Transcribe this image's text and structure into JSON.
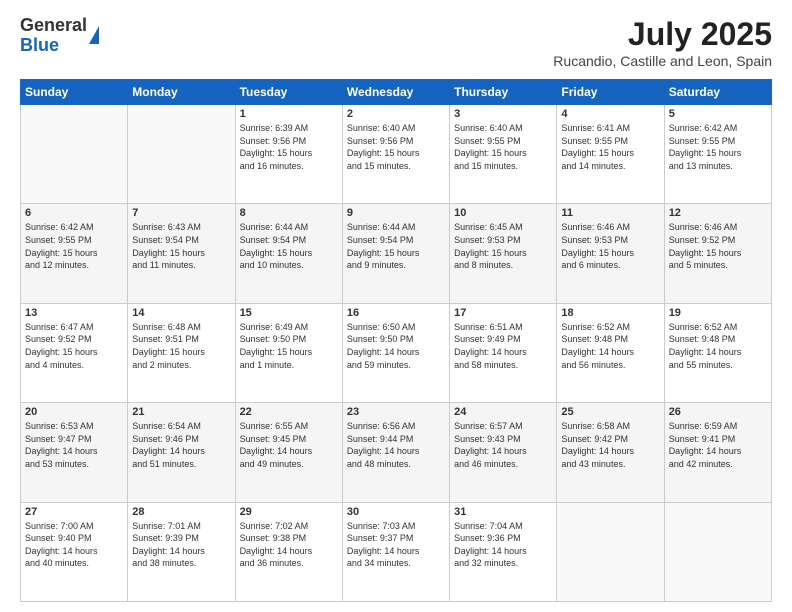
{
  "logo": {
    "line1": "General",
    "line2": "Blue"
  },
  "title": "July 2025",
  "subtitle": "Rucandio, Castille and Leon, Spain",
  "days_of_week": [
    "Sunday",
    "Monday",
    "Tuesday",
    "Wednesday",
    "Thursday",
    "Friday",
    "Saturday"
  ],
  "weeks": [
    [
      {
        "day": "",
        "info": ""
      },
      {
        "day": "",
        "info": ""
      },
      {
        "day": "1",
        "info": "Sunrise: 6:39 AM\nSunset: 9:56 PM\nDaylight: 15 hours\nand 16 minutes."
      },
      {
        "day": "2",
        "info": "Sunrise: 6:40 AM\nSunset: 9:56 PM\nDaylight: 15 hours\nand 15 minutes."
      },
      {
        "day": "3",
        "info": "Sunrise: 6:40 AM\nSunset: 9:55 PM\nDaylight: 15 hours\nand 15 minutes."
      },
      {
        "day": "4",
        "info": "Sunrise: 6:41 AM\nSunset: 9:55 PM\nDaylight: 15 hours\nand 14 minutes."
      },
      {
        "day": "5",
        "info": "Sunrise: 6:42 AM\nSunset: 9:55 PM\nDaylight: 15 hours\nand 13 minutes."
      }
    ],
    [
      {
        "day": "6",
        "info": "Sunrise: 6:42 AM\nSunset: 9:55 PM\nDaylight: 15 hours\nand 12 minutes."
      },
      {
        "day": "7",
        "info": "Sunrise: 6:43 AM\nSunset: 9:54 PM\nDaylight: 15 hours\nand 11 minutes."
      },
      {
        "day": "8",
        "info": "Sunrise: 6:44 AM\nSunset: 9:54 PM\nDaylight: 15 hours\nand 10 minutes."
      },
      {
        "day": "9",
        "info": "Sunrise: 6:44 AM\nSunset: 9:54 PM\nDaylight: 15 hours\nand 9 minutes."
      },
      {
        "day": "10",
        "info": "Sunrise: 6:45 AM\nSunset: 9:53 PM\nDaylight: 15 hours\nand 8 minutes."
      },
      {
        "day": "11",
        "info": "Sunrise: 6:46 AM\nSunset: 9:53 PM\nDaylight: 15 hours\nand 6 minutes."
      },
      {
        "day": "12",
        "info": "Sunrise: 6:46 AM\nSunset: 9:52 PM\nDaylight: 15 hours\nand 5 minutes."
      }
    ],
    [
      {
        "day": "13",
        "info": "Sunrise: 6:47 AM\nSunset: 9:52 PM\nDaylight: 15 hours\nand 4 minutes."
      },
      {
        "day": "14",
        "info": "Sunrise: 6:48 AM\nSunset: 9:51 PM\nDaylight: 15 hours\nand 2 minutes."
      },
      {
        "day": "15",
        "info": "Sunrise: 6:49 AM\nSunset: 9:50 PM\nDaylight: 15 hours\nand 1 minute."
      },
      {
        "day": "16",
        "info": "Sunrise: 6:50 AM\nSunset: 9:50 PM\nDaylight: 14 hours\nand 59 minutes."
      },
      {
        "day": "17",
        "info": "Sunrise: 6:51 AM\nSunset: 9:49 PM\nDaylight: 14 hours\nand 58 minutes."
      },
      {
        "day": "18",
        "info": "Sunrise: 6:52 AM\nSunset: 9:48 PM\nDaylight: 14 hours\nand 56 minutes."
      },
      {
        "day": "19",
        "info": "Sunrise: 6:52 AM\nSunset: 9:48 PM\nDaylight: 14 hours\nand 55 minutes."
      }
    ],
    [
      {
        "day": "20",
        "info": "Sunrise: 6:53 AM\nSunset: 9:47 PM\nDaylight: 14 hours\nand 53 minutes."
      },
      {
        "day": "21",
        "info": "Sunrise: 6:54 AM\nSunset: 9:46 PM\nDaylight: 14 hours\nand 51 minutes."
      },
      {
        "day": "22",
        "info": "Sunrise: 6:55 AM\nSunset: 9:45 PM\nDaylight: 14 hours\nand 49 minutes."
      },
      {
        "day": "23",
        "info": "Sunrise: 6:56 AM\nSunset: 9:44 PM\nDaylight: 14 hours\nand 48 minutes."
      },
      {
        "day": "24",
        "info": "Sunrise: 6:57 AM\nSunset: 9:43 PM\nDaylight: 14 hours\nand 46 minutes."
      },
      {
        "day": "25",
        "info": "Sunrise: 6:58 AM\nSunset: 9:42 PM\nDaylight: 14 hours\nand 43 minutes."
      },
      {
        "day": "26",
        "info": "Sunrise: 6:59 AM\nSunset: 9:41 PM\nDaylight: 14 hours\nand 42 minutes."
      }
    ],
    [
      {
        "day": "27",
        "info": "Sunrise: 7:00 AM\nSunset: 9:40 PM\nDaylight: 14 hours\nand 40 minutes."
      },
      {
        "day": "28",
        "info": "Sunrise: 7:01 AM\nSunset: 9:39 PM\nDaylight: 14 hours\nand 38 minutes."
      },
      {
        "day": "29",
        "info": "Sunrise: 7:02 AM\nSunset: 9:38 PM\nDaylight: 14 hours\nand 36 minutes."
      },
      {
        "day": "30",
        "info": "Sunrise: 7:03 AM\nSunset: 9:37 PM\nDaylight: 14 hours\nand 34 minutes."
      },
      {
        "day": "31",
        "info": "Sunrise: 7:04 AM\nSunset: 9:36 PM\nDaylight: 14 hours\nand 32 minutes."
      },
      {
        "day": "",
        "info": ""
      },
      {
        "day": "",
        "info": ""
      }
    ]
  ]
}
